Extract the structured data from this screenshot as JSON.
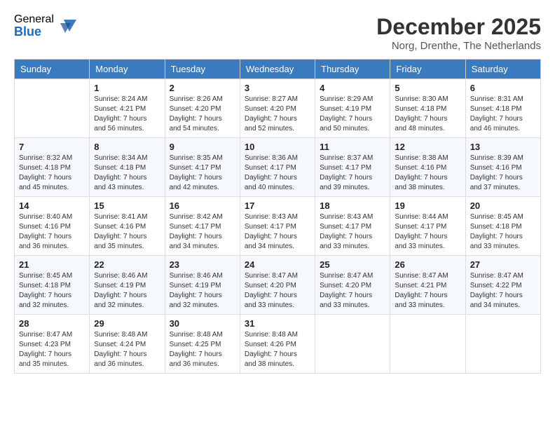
{
  "header": {
    "logo": {
      "general": "General",
      "blue": "Blue"
    },
    "title": "December 2025",
    "location": "Norg, Drenthe, The Netherlands"
  },
  "calendar": {
    "days_of_week": [
      "Sunday",
      "Monday",
      "Tuesday",
      "Wednesday",
      "Thursday",
      "Friday",
      "Saturday"
    ],
    "weeks": [
      [
        {
          "day": "",
          "info": ""
        },
        {
          "day": "1",
          "info": "Sunrise: 8:24 AM\nSunset: 4:21 PM\nDaylight: 7 hours\nand 56 minutes."
        },
        {
          "day": "2",
          "info": "Sunrise: 8:26 AM\nSunset: 4:20 PM\nDaylight: 7 hours\nand 54 minutes."
        },
        {
          "day": "3",
          "info": "Sunrise: 8:27 AM\nSunset: 4:20 PM\nDaylight: 7 hours\nand 52 minutes."
        },
        {
          "day": "4",
          "info": "Sunrise: 8:29 AM\nSunset: 4:19 PM\nDaylight: 7 hours\nand 50 minutes."
        },
        {
          "day": "5",
          "info": "Sunrise: 8:30 AM\nSunset: 4:18 PM\nDaylight: 7 hours\nand 48 minutes."
        },
        {
          "day": "6",
          "info": "Sunrise: 8:31 AM\nSunset: 4:18 PM\nDaylight: 7 hours\nand 46 minutes."
        }
      ],
      [
        {
          "day": "7",
          "info": "Sunrise: 8:32 AM\nSunset: 4:18 PM\nDaylight: 7 hours\nand 45 minutes."
        },
        {
          "day": "8",
          "info": "Sunrise: 8:34 AM\nSunset: 4:18 PM\nDaylight: 7 hours\nand 43 minutes."
        },
        {
          "day": "9",
          "info": "Sunrise: 8:35 AM\nSunset: 4:17 PM\nDaylight: 7 hours\nand 42 minutes."
        },
        {
          "day": "10",
          "info": "Sunrise: 8:36 AM\nSunset: 4:17 PM\nDaylight: 7 hours\nand 40 minutes."
        },
        {
          "day": "11",
          "info": "Sunrise: 8:37 AM\nSunset: 4:17 PM\nDaylight: 7 hours\nand 39 minutes."
        },
        {
          "day": "12",
          "info": "Sunrise: 8:38 AM\nSunset: 4:16 PM\nDaylight: 7 hours\nand 38 minutes."
        },
        {
          "day": "13",
          "info": "Sunrise: 8:39 AM\nSunset: 4:16 PM\nDaylight: 7 hours\nand 37 minutes."
        }
      ],
      [
        {
          "day": "14",
          "info": "Sunrise: 8:40 AM\nSunset: 4:16 PM\nDaylight: 7 hours\nand 36 minutes."
        },
        {
          "day": "15",
          "info": "Sunrise: 8:41 AM\nSunset: 4:16 PM\nDaylight: 7 hours\nand 35 minutes."
        },
        {
          "day": "16",
          "info": "Sunrise: 8:42 AM\nSunset: 4:17 PM\nDaylight: 7 hours\nand 34 minutes."
        },
        {
          "day": "17",
          "info": "Sunrise: 8:43 AM\nSunset: 4:17 PM\nDaylight: 7 hours\nand 34 minutes."
        },
        {
          "day": "18",
          "info": "Sunrise: 8:43 AM\nSunset: 4:17 PM\nDaylight: 7 hours\nand 33 minutes."
        },
        {
          "day": "19",
          "info": "Sunrise: 8:44 AM\nSunset: 4:17 PM\nDaylight: 7 hours\nand 33 minutes."
        },
        {
          "day": "20",
          "info": "Sunrise: 8:45 AM\nSunset: 4:18 PM\nDaylight: 7 hours\nand 33 minutes."
        }
      ],
      [
        {
          "day": "21",
          "info": "Sunrise: 8:45 AM\nSunset: 4:18 PM\nDaylight: 7 hours\nand 32 minutes."
        },
        {
          "day": "22",
          "info": "Sunrise: 8:46 AM\nSunset: 4:19 PM\nDaylight: 7 hours\nand 32 minutes."
        },
        {
          "day": "23",
          "info": "Sunrise: 8:46 AM\nSunset: 4:19 PM\nDaylight: 7 hours\nand 32 minutes."
        },
        {
          "day": "24",
          "info": "Sunrise: 8:47 AM\nSunset: 4:20 PM\nDaylight: 7 hours\nand 33 minutes."
        },
        {
          "day": "25",
          "info": "Sunrise: 8:47 AM\nSunset: 4:20 PM\nDaylight: 7 hours\nand 33 minutes."
        },
        {
          "day": "26",
          "info": "Sunrise: 8:47 AM\nSunset: 4:21 PM\nDaylight: 7 hours\nand 33 minutes."
        },
        {
          "day": "27",
          "info": "Sunrise: 8:47 AM\nSunset: 4:22 PM\nDaylight: 7 hours\nand 34 minutes."
        }
      ],
      [
        {
          "day": "28",
          "info": "Sunrise: 8:47 AM\nSunset: 4:23 PM\nDaylight: 7 hours\nand 35 minutes."
        },
        {
          "day": "29",
          "info": "Sunrise: 8:48 AM\nSunset: 4:24 PM\nDaylight: 7 hours\nand 36 minutes."
        },
        {
          "day": "30",
          "info": "Sunrise: 8:48 AM\nSunset: 4:25 PM\nDaylight: 7 hours\nand 36 minutes."
        },
        {
          "day": "31",
          "info": "Sunrise: 8:48 AM\nSunset: 4:26 PM\nDaylight: 7 hours\nand 38 minutes."
        },
        {
          "day": "",
          "info": ""
        },
        {
          "day": "",
          "info": ""
        },
        {
          "day": "",
          "info": ""
        }
      ]
    ]
  }
}
